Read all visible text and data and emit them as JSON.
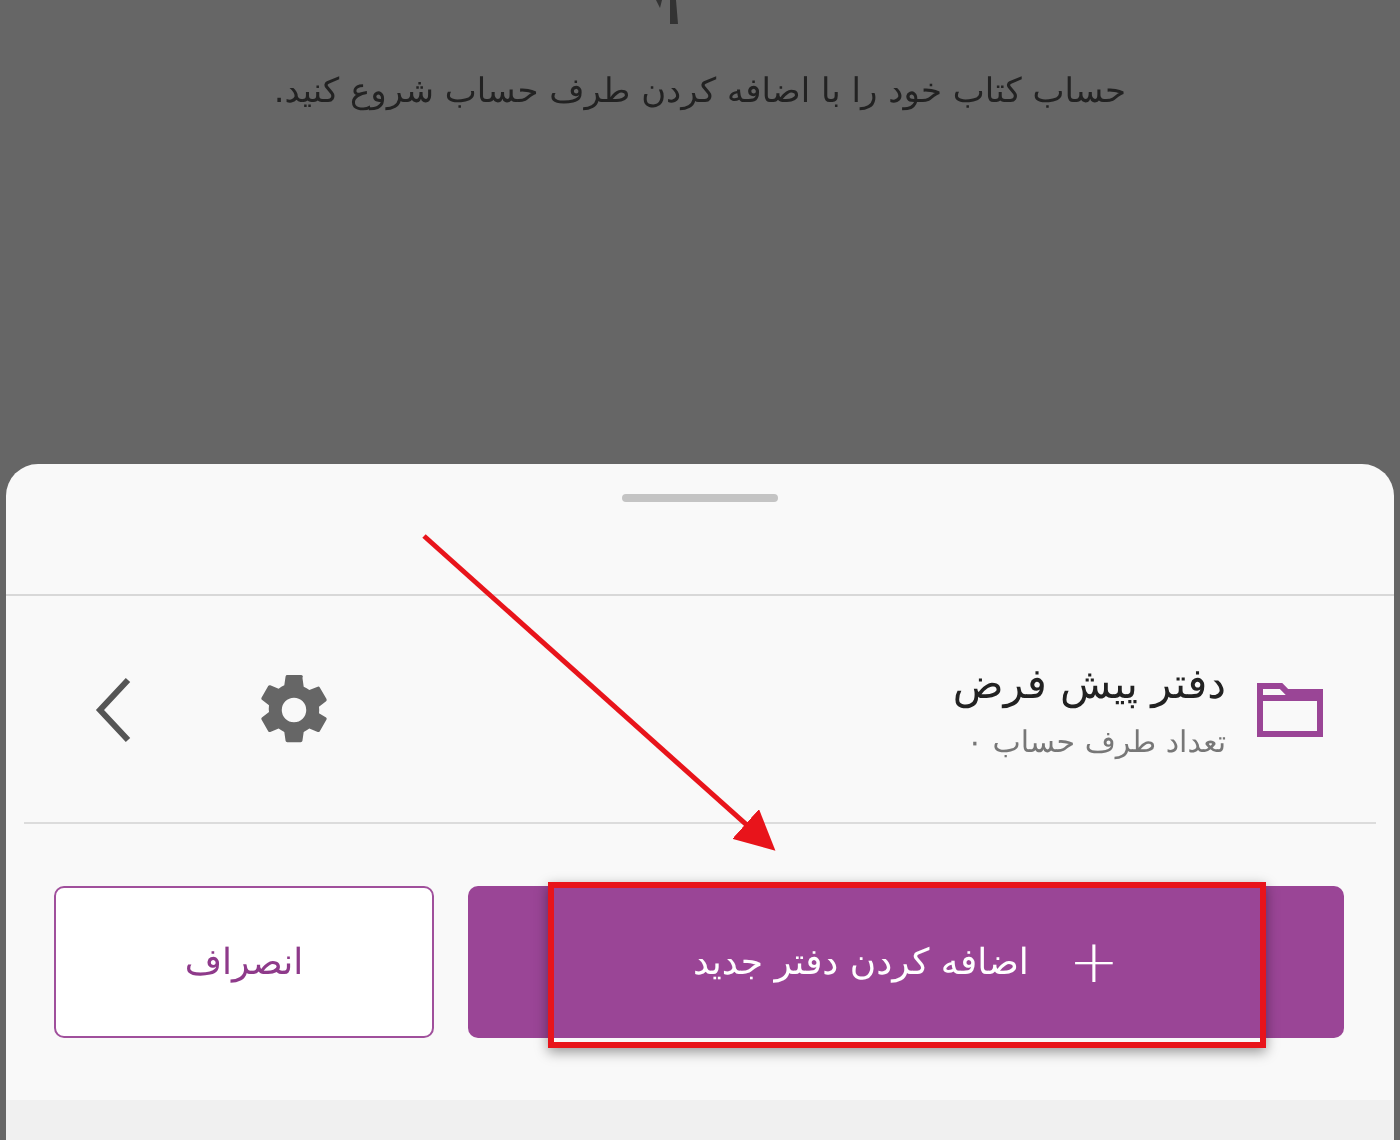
{
  "background": {
    "message": "حساب کتاب خود را با اضافه کردن طرف حساب شروع کنید."
  },
  "sheet": {
    "notebook": {
      "title": "دفتر پیش فرض",
      "subtitle": "تعداد طرف حساب ۰"
    },
    "buttons": [
      {
        "kind": "primary",
        "icon": "+",
        "label": "اضافه کردن دفتر جدید"
      },
      {
        "kind": "outline",
        "label": "انصراف"
      }
    ]
  }
}
